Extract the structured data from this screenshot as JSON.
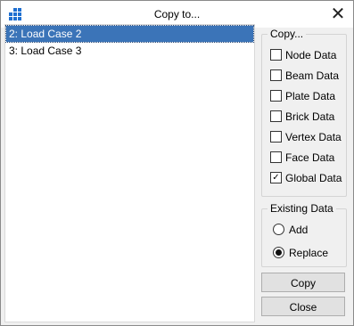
{
  "window": {
    "title": "Copy to...",
    "close_glyph": "✕",
    "app_icon": "grid-app-icon"
  },
  "load_cases": [
    {
      "label": "2: Load Case 2",
      "selected": true
    },
    {
      "label": "3: Load Case 3",
      "selected": false
    }
  ],
  "copy_group": {
    "legend": "Copy...",
    "options": [
      {
        "label": "Node Data",
        "checked": false
      },
      {
        "label": "Beam Data",
        "checked": false
      },
      {
        "label": "Plate Data",
        "checked": false
      },
      {
        "label": "Brick Data",
        "checked": false
      },
      {
        "label": "Vertex Data",
        "checked": false
      },
      {
        "label": "Face Data",
        "checked": false
      },
      {
        "label": "Global Data",
        "checked": true
      }
    ]
  },
  "existing_group": {
    "legend": "Existing Data",
    "options": [
      {
        "label": "Add",
        "selected": false
      },
      {
        "label": "Replace",
        "selected": true
      }
    ]
  },
  "buttons": {
    "copy": "Copy",
    "close": "Close"
  },
  "colors": {
    "selection": "#3b74b8",
    "icon_blue": "#1f6fd1"
  }
}
